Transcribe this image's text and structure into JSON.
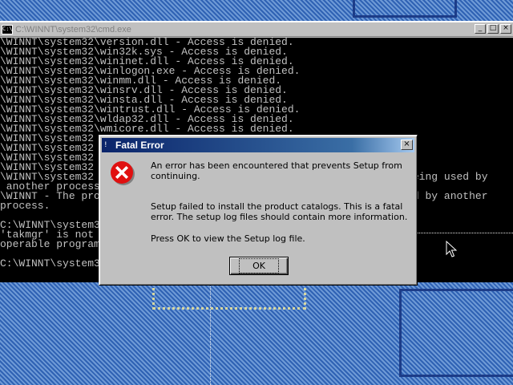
{
  "cmd": {
    "title": "C:\\WINNT\\system32\\cmd.exe",
    "icon_text": "C:\\",
    "controls": {
      "minimize": "_",
      "maximize": "□",
      "close": "×"
    },
    "lines": [
      "\\WINNT\\system32\\version.dll - Access is denied.",
      "\\WINNT\\system32\\win32k.sys - Access is denied.",
      "\\WINNT\\system32\\wininet.dll - Access is denied.",
      "\\WINNT\\system32\\winlogon.exe - Access is denied.",
      "\\WINNT\\system32\\winmm.dll - Access is denied.",
      "\\WINNT\\system32\\winsrv.dll - Access is denied.",
      "\\WINNT\\system32\\winsta.dll - Access is denied.",
      "\\WINNT\\system32\\wintrust.dll - Access is denied.",
      "\\WINNT\\system32\\wldap32.dll - Access is denied.",
      "\\WINNT\\system32\\wmicore.dll - Access is denied.",
      "\\WINNT\\system32",
      "\\WINNT\\system32",
      "\\WINNT\\system32",
      "\\WINNT\\system32",
      "\\WINNT\\system32                                                s being used by",
      " another process",
      "\\WINNT - The pro                                                sed by another",
      "process.",
      "",
      "C:\\WINNT\\system3",
      "'takmgr' is not",
      "operable program",
      "",
      "C:\\WINNT\\system3"
    ]
  },
  "dialog": {
    "title": "Fatal Error",
    "title_icon": "!",
    "close": "×",
    "message_1": "An error has been encountered that prevents Setup from continuing.",
    "message_2": "Setup failed to install the product catalogs. This is a fatal error. The setup log files should contain more information.",
    "message_3": "Press OK to view the Setup log file.",
    "ok_label": "OK"
  },
  "colors": {
    "desktop": "#3a6ea5",
    "title_active": "#0a246a",
    "error_red": "#e01010"
  }
}
